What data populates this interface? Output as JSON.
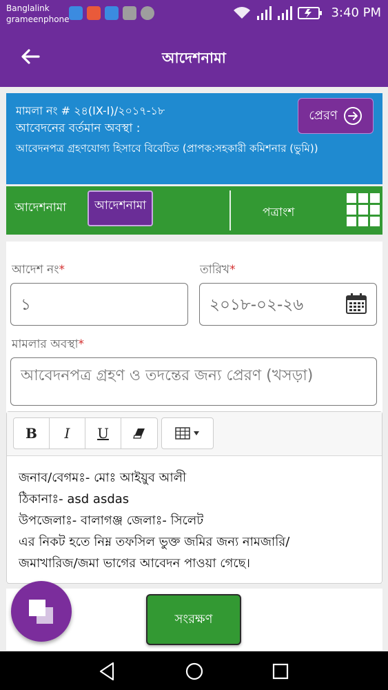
{
  "status_bar": {
    "carrier1": "Banglalink",
    "carrier2": "grameenphone",
    "time": "3:40 PM"
  },
  "app_bar": {
    "title": "আদেশনামা"
  },
  "case": {
    "number": "মামলা নং #  ২৪(IX-I)/২০১৭-১৮",
    "state_label": "আবেদনের বর্তমান অবস্থা :",
    "state_value": "আবেদনপত্র গ্রহণযোগ্য হিসাবে বিবেচিত   (প্রাপক:সহকারী কমিশনার (ভুমি))",
    "send_label": "প্রেরণ"
  },
  "tabs": {
    "tab1": "আদেশনামা",
    "tab2": "আদেশনামা",
    "tab3": "পত্রাংশ"
  },
  "form": {
    "order_no_label": "আদেশ নং",
    "order_no_value": "১",
    "date_label": "তারিখ",
    "date_value": "২০১৮-০২-২৬",
    "case_status_label": "মামলার অবস্থা",
    "case_status_value": "আবেদনপত্র গ্রহণ ও তদন্তের জন্য প্রেরণ (খসড়া)",
    "required_mark": "*"
  },
  "editor": {
    "toolbar": {
      "bold": "B",
      "italic": "I",
      "underline": "U"
    },
    "lines": [
      "জনাব/বেগমঃ- মোঃ আইয়ুব আলী",
      "ঠিকানাঃ- asd asdas",
      "উপজেলাঃ- বালাগঞ্জ জেলাঃ- সিলেট",
      "এর নিকট হতে নিম্ন তফসিল ভুক্ত জমির জন্য নামজারি/",
      "জমাখারিজ/জমা ভাগের আবেদন পাওয়া গেছে।"
    ]
  },
  "save_label": "সংরক্ষণ",
  "colors": {
    "primary_purple": "#6d2c9b",
    "info_blue": "#1f8ad0",
    "tab_green": "#339933"
  }
}
